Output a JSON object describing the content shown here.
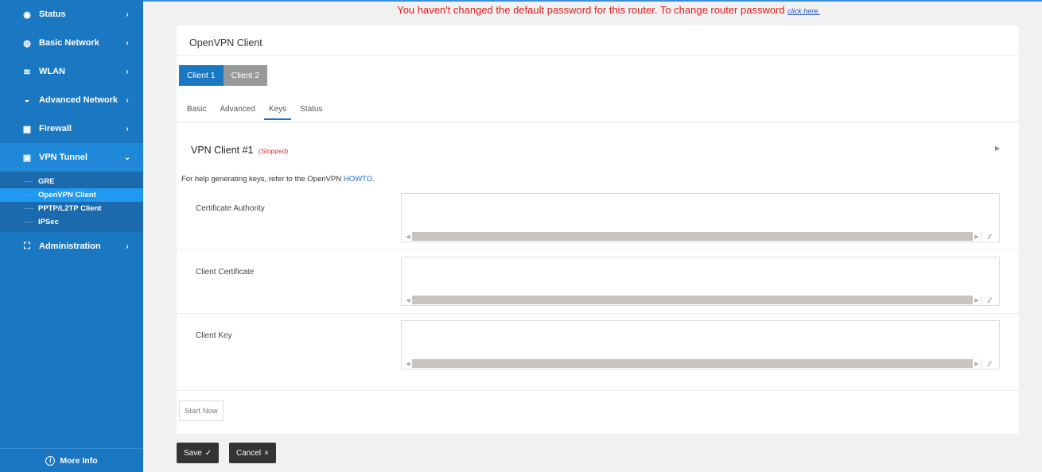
{
  "sidebar": {
    "items": [
      {
        "label": "Status",
        "icon": "eye-icon",
        "glyph": "◉",
        "chev": "›"
      },
      {
        "label": "Basic Network",
        "icon": "globe-icon",
        "glyph": "◍",
        "chev": "›"
      },
      {
        "label": "WLAN",
        "icon": "wifi-icon",
        "glyph": "≋",
        "chev": "›"
      },
      {
        "label": "Advanced Network",
        "icon": "network-icon",
        "glyph": "◒",
        "chev": "›"
      },
      {
        "label": "Firewall",
        "icon": "firewall-icon",
        "glyph": "▩",
        "chev": "›"
      },
      {
        "label": "VPN Tunnel",
        "icon": "vpn-icon",
        "glyph": "▣",
        "chev": "⌄"
      },
      {
        "label": "Administration",
        "icon": "admin-icon",
        "glyph": "⛶",
        "chev": "›"
      }
    ],
    "submenu": [
      "GRE",
      "OpenVPN Client",
      "PPTP/L2TP Client",
      "IPSec"
    ],
    "more_info": "More Info"
  },
  "warning": {
    "text": "You haven't changed the default password for this router. To change router password",
    "link": "click here."
  },
  "card": {
    "title": "OpenVPN Client",
    "client_tabs": [
      "Client 1",
      "Client 2"
    ],
    "sub_tabs": [
      "Basic",
      "Advanced",
      "Keys",
      "Status"
    ],
    "section_title": "VPN Client #1",
    "section_state": "(Stopped)",
    "help_prefix": "For help generating keys, refer to the OpenVPN",
    "help_link": "HOWTO",
    "help_suffix": ".",
    "fields": [
      {
        "label": "Certificate Authority",
        "value": ""
      },
      {
        "label": "Client Certificate",
        "value": ""
      },
      {
        "label": "Client Key",
        "value": ""
      }
    ],
    "start_button": "Start Now"
  },
  "actions": {
    "save": "Save",
    "save_icon": "✓",
    "cancel": "Cancel",
    "cancel_icon": "×"
  },
  "colors": {
    "sidebar": "#1a78c2",
    "accent": "#1a78c2",
    "warning": "#e02020",
    "stopped": "#e03030"
  }
}
